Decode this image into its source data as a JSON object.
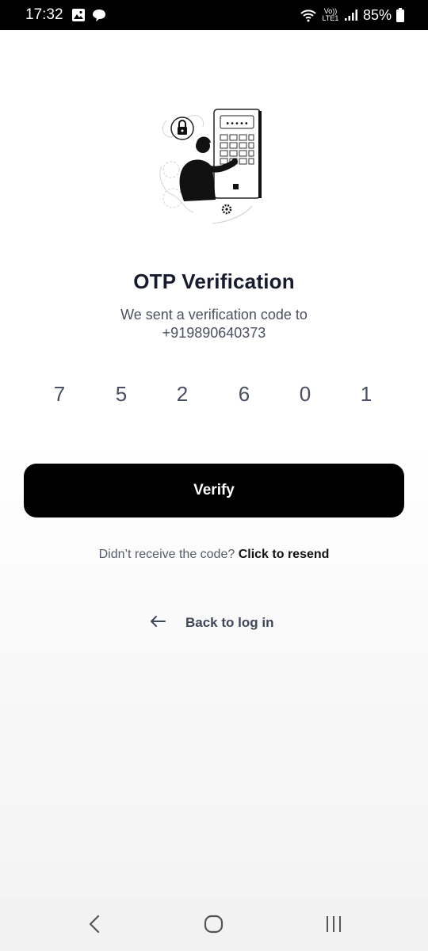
{
  "status_bar": {
    "time": "17:32",
    "network_label": "Vo)) LTE1",
    "battery_percent": "85%",
    "icons": [
      "gallery-icon",
      "chat-icon",
      "wifi-icon",
      "signal-icon",
      "battery-icon"
    ]
  },
  "illustration": {
    "keypad_dots": "•••••",
    "icon": "person-keypad-lock-illustration"
  },
  "screen": {
    "title": "OTP Verification",
    "subtitle_line1": "We sent a verification code to",
    "phone_number": "+919890640373"
  },
  "otp": {
    "digits": [
      "7",
      "5",
      "2",
      "6",
      "0",
      "1"
    ]
  },
  "actions": {
    "verify_label": "Verify",
    "resend_prompt": "Didn’t receive the code?",
    "resend_link": "Click to resend",
    "back_label": "Back to log in"
  },
  "nav_bar": {
    "icons": [
      "back-icon",
      "home-icon",
      "recents-icon"
    ]
  },
  "colors": {
    "primary_button": "#000000",
    "title_text": "#161b2e",
    "body_text": "#4b5160"
  }
}
